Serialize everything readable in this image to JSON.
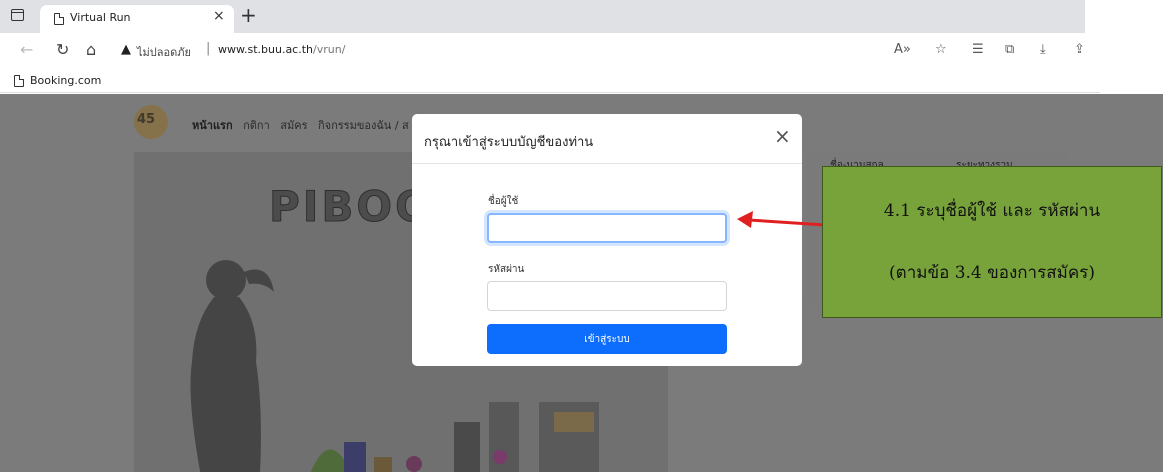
{
  "browser": {
    "tab_title": "Virtual Run",
    "tab_close": "×",
    "new_tab": "+",
    "security_label": "ไม่ปลอดภัย",
    "url_host": "www.st.buu.ac.th",
    "url_path": "/vrun/",
    "bookmark_label": "Booking.com",
    "icons": [
      "tab-actions-icon",
      "page-icon",
      "back-icon",
      "reload-icon",
      "home-icon",
      "warning-icon",
      "read-aloud-icon",
      "favorite-icon",
      "favorites-list-icon",
      "collections-icon",
      "downloads-icon",
      "share-icon"
    ]
  },
  "site": {
    "logo_text": "45",
    "nav_active": "หน้าแรก",
    "nav_items": [
      "กติกา",
      "สมัคร",
      "กิจกรรมของฉัน / ส"
    ],
    "hero_title": "PIBOO",
    "table_headers": [
      "ชื่อ-นามสกุล",
      "ระยะทางรวม"
    ]
  },
  "modal": {
    "title": "กรุณาเข้าสู่ระบบบัญชีของท่าน",
    "close": "×",
    "username_label": "ชื่อผู้ใช้",
    "username_value": "",
    "password_label": "รหัสผ่าน",
    "password_value": "",
    "login_button": "เข้าสู่ระบบ"
  },
  "annotation": {
    "line1": "4.1 ระบุชื่อผู้ใช้ และ รหัสผ่าน",
    "line2": "(ตามข้อ 3.4 ของการสมัคร)"
  },
  "colors": {
    "backdrop": "#7b7b7b",
    "primary_button": "#0d6efd",
    "callout_bg": "#78a33b",
    "arrow": "#e02020"
  }
}
